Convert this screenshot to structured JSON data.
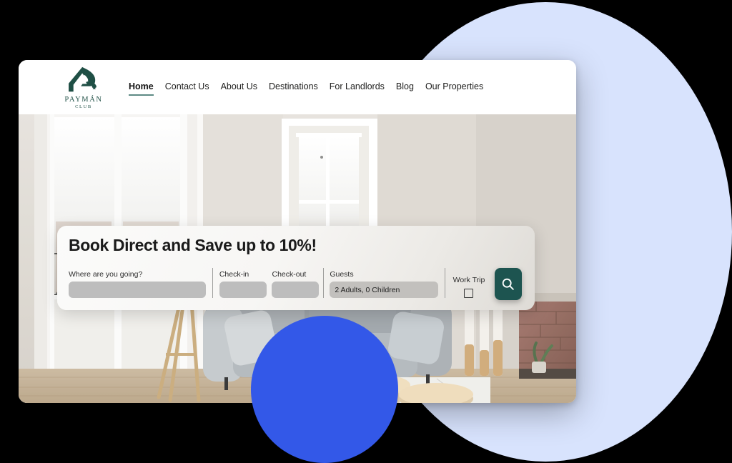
{
  "brand": {
    "name": "PAYMÁN",
    "sub": "CLUB",
    "logo_icon": "payman-spade-logo-icon",
    "color": "#1f4f45"
  },
  "nav": {
    "items": [
      {
        "label": "Home",
        "active": true
      },
      {
        "label": "Contact Us",
        "active": false
      },
      {
        "label": "About Us",
        "active": false
      },
      {
        "label": "Destinations",
        "active": false
      },
      {
        "label": "For Landlords",
        "active": false
      },
      {
        "label": "Blog",
        "active": false
      },
      {
        "label": "Our Properties",
        "active": false
      }
    ],
    "active_underline_color": "#5d8a84"
  },
  "hero": {
    "description": "Bright living room interior with grey sofa, wooden nesting tables, tall candles, potted plant and brick fireplace"
  },
  "search_panel": {
    "title": "Book Direct and Save up to 10%!",
    "destination": {
      "label": "Where are you going?",
      "value": "",
      "placeholder": ""
    },
    "checkin": {
      "label": "Check-in",
      "value": ""
    },
    "checkout": {
      "label": "Check-out",
      "value": ""
    },
    "guests": {
      "label": "Guests",
      "value": "2 Adults, 0 Children"
    },
    "work_trip": {
      "label": "Work Trip",
      "checked": false
    },
    "search_button": {
      "icon": "search-icon",
      "color": "#1d5450"
    }
  },
  "decor": {
    "light_circle_color": "#d8e3fd",
    "blue_circle_color": "#3358e8",
    "page_background": "#000000"
  }
}
